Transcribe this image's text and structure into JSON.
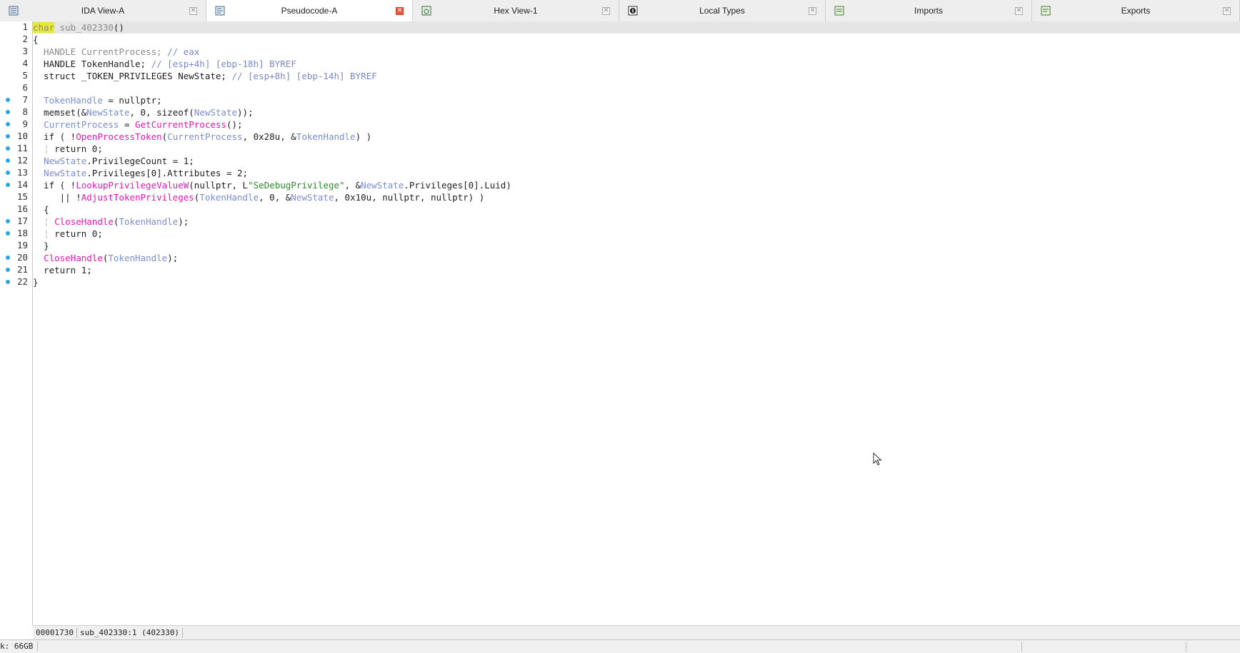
{
  "tabs": [
    {
      "label": "IDA View-A",
      "icon": "ida-view-icon",
      "active": false
    },
    {
      "label": "Pseudocode-A",
      "icon": "pseudocode-icon",
      "active": true
    },
    {
      "label": "Hex View-1",
      "icon": "hex-view-icon",
      "active": false
    },
    {
      "label": "Local Types",
      "icon": "local-types-icon",
      "active": false
    },
    {
      "label": "Imports",
      "icon": "imports-icon",
      "active": false
    },
    {
      "label": "Exports",
      "icon": "exports-icon",
      "active": false
    }
  ],
  "code_lines": [
    {
      "n": "1",
      "dot": false
    },
    {
      "n": "2",
      "dot": false
    },
    {
      "n": "3",
      "dot": false
    },
    {
      "n": "4",
      "dot": false
    },
    {
      "n": "5",
      "dot": false
    },
    {
      "n": "6",
      "dot": false
    },
    {
      "n": "7",
      "dot": true
    },
    {
      "n": "8",
      "dot": true
    },
    {
      "n": "9",
      "dot": true
    },
    {
      "n": "10",
      "dot": true
    },
    {
      "n": "11",
      "dot": true
    },
    {
      "n": "12",
      "dot": true
    },
    {
      "n": "13",
      "dot": true
    },
    {
      "n": "14",
      "dot": true
    },
    {
      "n": "15",
      "dot": false
    },
    {
      "n": "16",
      "dot": false
    },
    {
      "n": "17",
      "dot": true
    },
    {
      "n": "18",
      "dot": true
    },
    {
      "n": "19",
      "dot": false
    },
    {
      "n": "20",
      "dot": true
    },
    {
      "n": "21",
      "dot": true
    },
    {
      "n": "22",
      "dot": true
    }
  ],
  "code": {
    "l1_kw": "char",
    "l1_rest": " sub_402330",
    "l1_paren": "()",
    "l2": "{",
    "l3_type": "  HANDLE ",
    "l3_var": "CurrentProcess; ",
    "l3_cmt": "// eax",
    "l4_type": "  HANDLE TokenHandle; ",
    "l4_cmt": "// [esp+4h] [ebp-18h] BYREF",
    "l5_type": "  struct _TOKEN_PRIVILEGES NewState; ",
    "l5_cmt": "// [esp+8h] [ebp-14h] BYREF",
    "l6": "",
    "l7_var": "TokenHandle",
    "l7_rest": " = nullptr;",
    "l8_a": "  memset(&",
    "l8_var": "NewState",
    "l8_b": ", 0, sizeof(",
    "l8_var2": "NewState",
    "l8_c": "));",
    "l9_var": "CurrentProcess",
    "l9_b": " = ",
    "l9_fn": "GetCurrentProcess",
    "l9_c": "();",
    "l10_a": "  if ( !",
    "l10_fn": "OpenProcessToken",
    "l10_b": "(",
    "l10_var": "CurrentProcess",
    "l10_c": ", 0x28u, &",
    "l10_var2": "TokenHandle",
    "l10_d": ") )",
    "l11": "return 0;",
    "l12_var": "NewState",
    "l12_rest": ".PrivilegeCount = 1;",
    "l13_var": "NewState",
    "l13_rest": ".Privileges[0].Attributes = 2;",
    "l14_a": "  if ( !",
    "l14_fn": "LookupPrivilegeValueW",
    "l14_b": "(nullptr, L",
    "l14_str": "\"SeDebugPrivilege\"",
    "l14_c": ", &",
    "l14_var": "NewState",
    "l14_d": ".Privileges[0].Luid)",
    "l15_a": "|| !",
    "l15_fn": "AdjustTokenPrivileges",
    "l15_b": "(",
    "l15_var": "TokenHandle",
    "l15_c": ", 0, &",
    "l15_var2": "NewState",
    "l15_d": ", 0x10u, nullptr, nullptr) )",
    "l16": "{",
    "l17_fn": "CloseHandle",
    "l17_b": "(",
    "l17_var": "TokenHandle",
    "l17_c": ");",
    "l18": "return 0;",
    "l19": "}",
    "l20_fn": "CloseHandle",
    "l20_b": "(",
    "l20_var": "TokenHandle",
    "l20_c": ");",
    "l21": "  return 1;",
    "l22": "}"
  },
  "status": {
    "offset": "00001730",
    "location": "sub_402330:1 (402330)"
  },
  "bottom": {
    "disk": "k: 66GB"
  },
  "colors": {
    "accent": "#2aa6de",
    "function": "#e01ab7",
    "variable": "#7b8ed1",
    "string": "#2b8a2b",
    "active_close": "#e8583e"
  }
}
